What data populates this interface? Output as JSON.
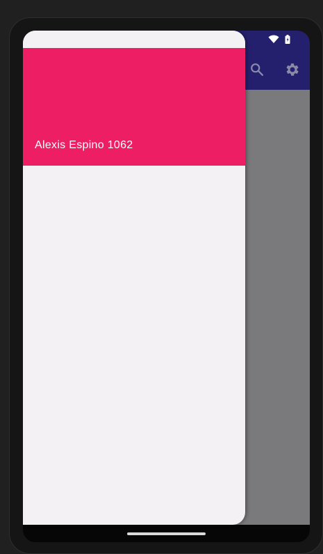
{
  "status_bar": {
    "icons": [
      "wifi-icon",
      "battery-icon"
    ]
  },
  "app_bar": {
    "actions": [
      "search-icon",
      "gear-icon"
    ],
    "background": "#24206e"
  },
  "drawer": {
    "header": {
      "title": "Alexis Espino 1062",
      "background": "#ee1e64"
    },
    "items": []
  },
  "colors": {
    "scrim": "#7a797c",
    "drawer_bg": "#f4f1f5"
  }
}
